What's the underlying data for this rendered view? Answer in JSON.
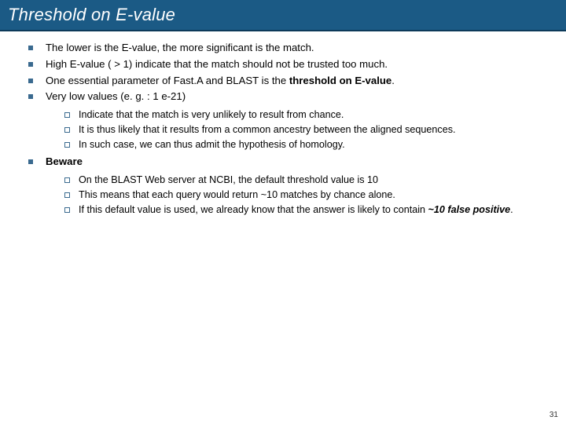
{
  "title": "Threshold on E-value",
  "bullets": {
    "b1": "The lower is the E-value, the more significant is the match.",
    "b2": "High E-value ( > 1) indicate that the match should not be trusted too much.",
    "b3_a": "One essential parameter of Fast.A and BLAST is the ",
    "b3_b": "threshold on E-value",
    "b3_c": ".",
    "b4": "Very low values (e. g. : 1 e-21)",
    "b4_sub": {
      "s1": "Indicate that the match is very unlikely to result from chance.",
      "s2": "It is thus likely that it results from a common ancestry between the aligned sequences.",
      "s3": "In such case, we can thus admit the hypothesis of homology."
    },
    "b5": "Beware",
    "b5_sub": {
      "s1": "On the BLAST Web server at NCBI, the default threshold value is 10",
      "s2": "This means that each query would return ~10 matches by chance alone.",
      "s3_a": "If this default value is used, we already know that the answer is likely to contain ",
      "s3_b": "~10 false positive",
      "s3_c": "."
    }
  },
  "page_number": "31"
}
